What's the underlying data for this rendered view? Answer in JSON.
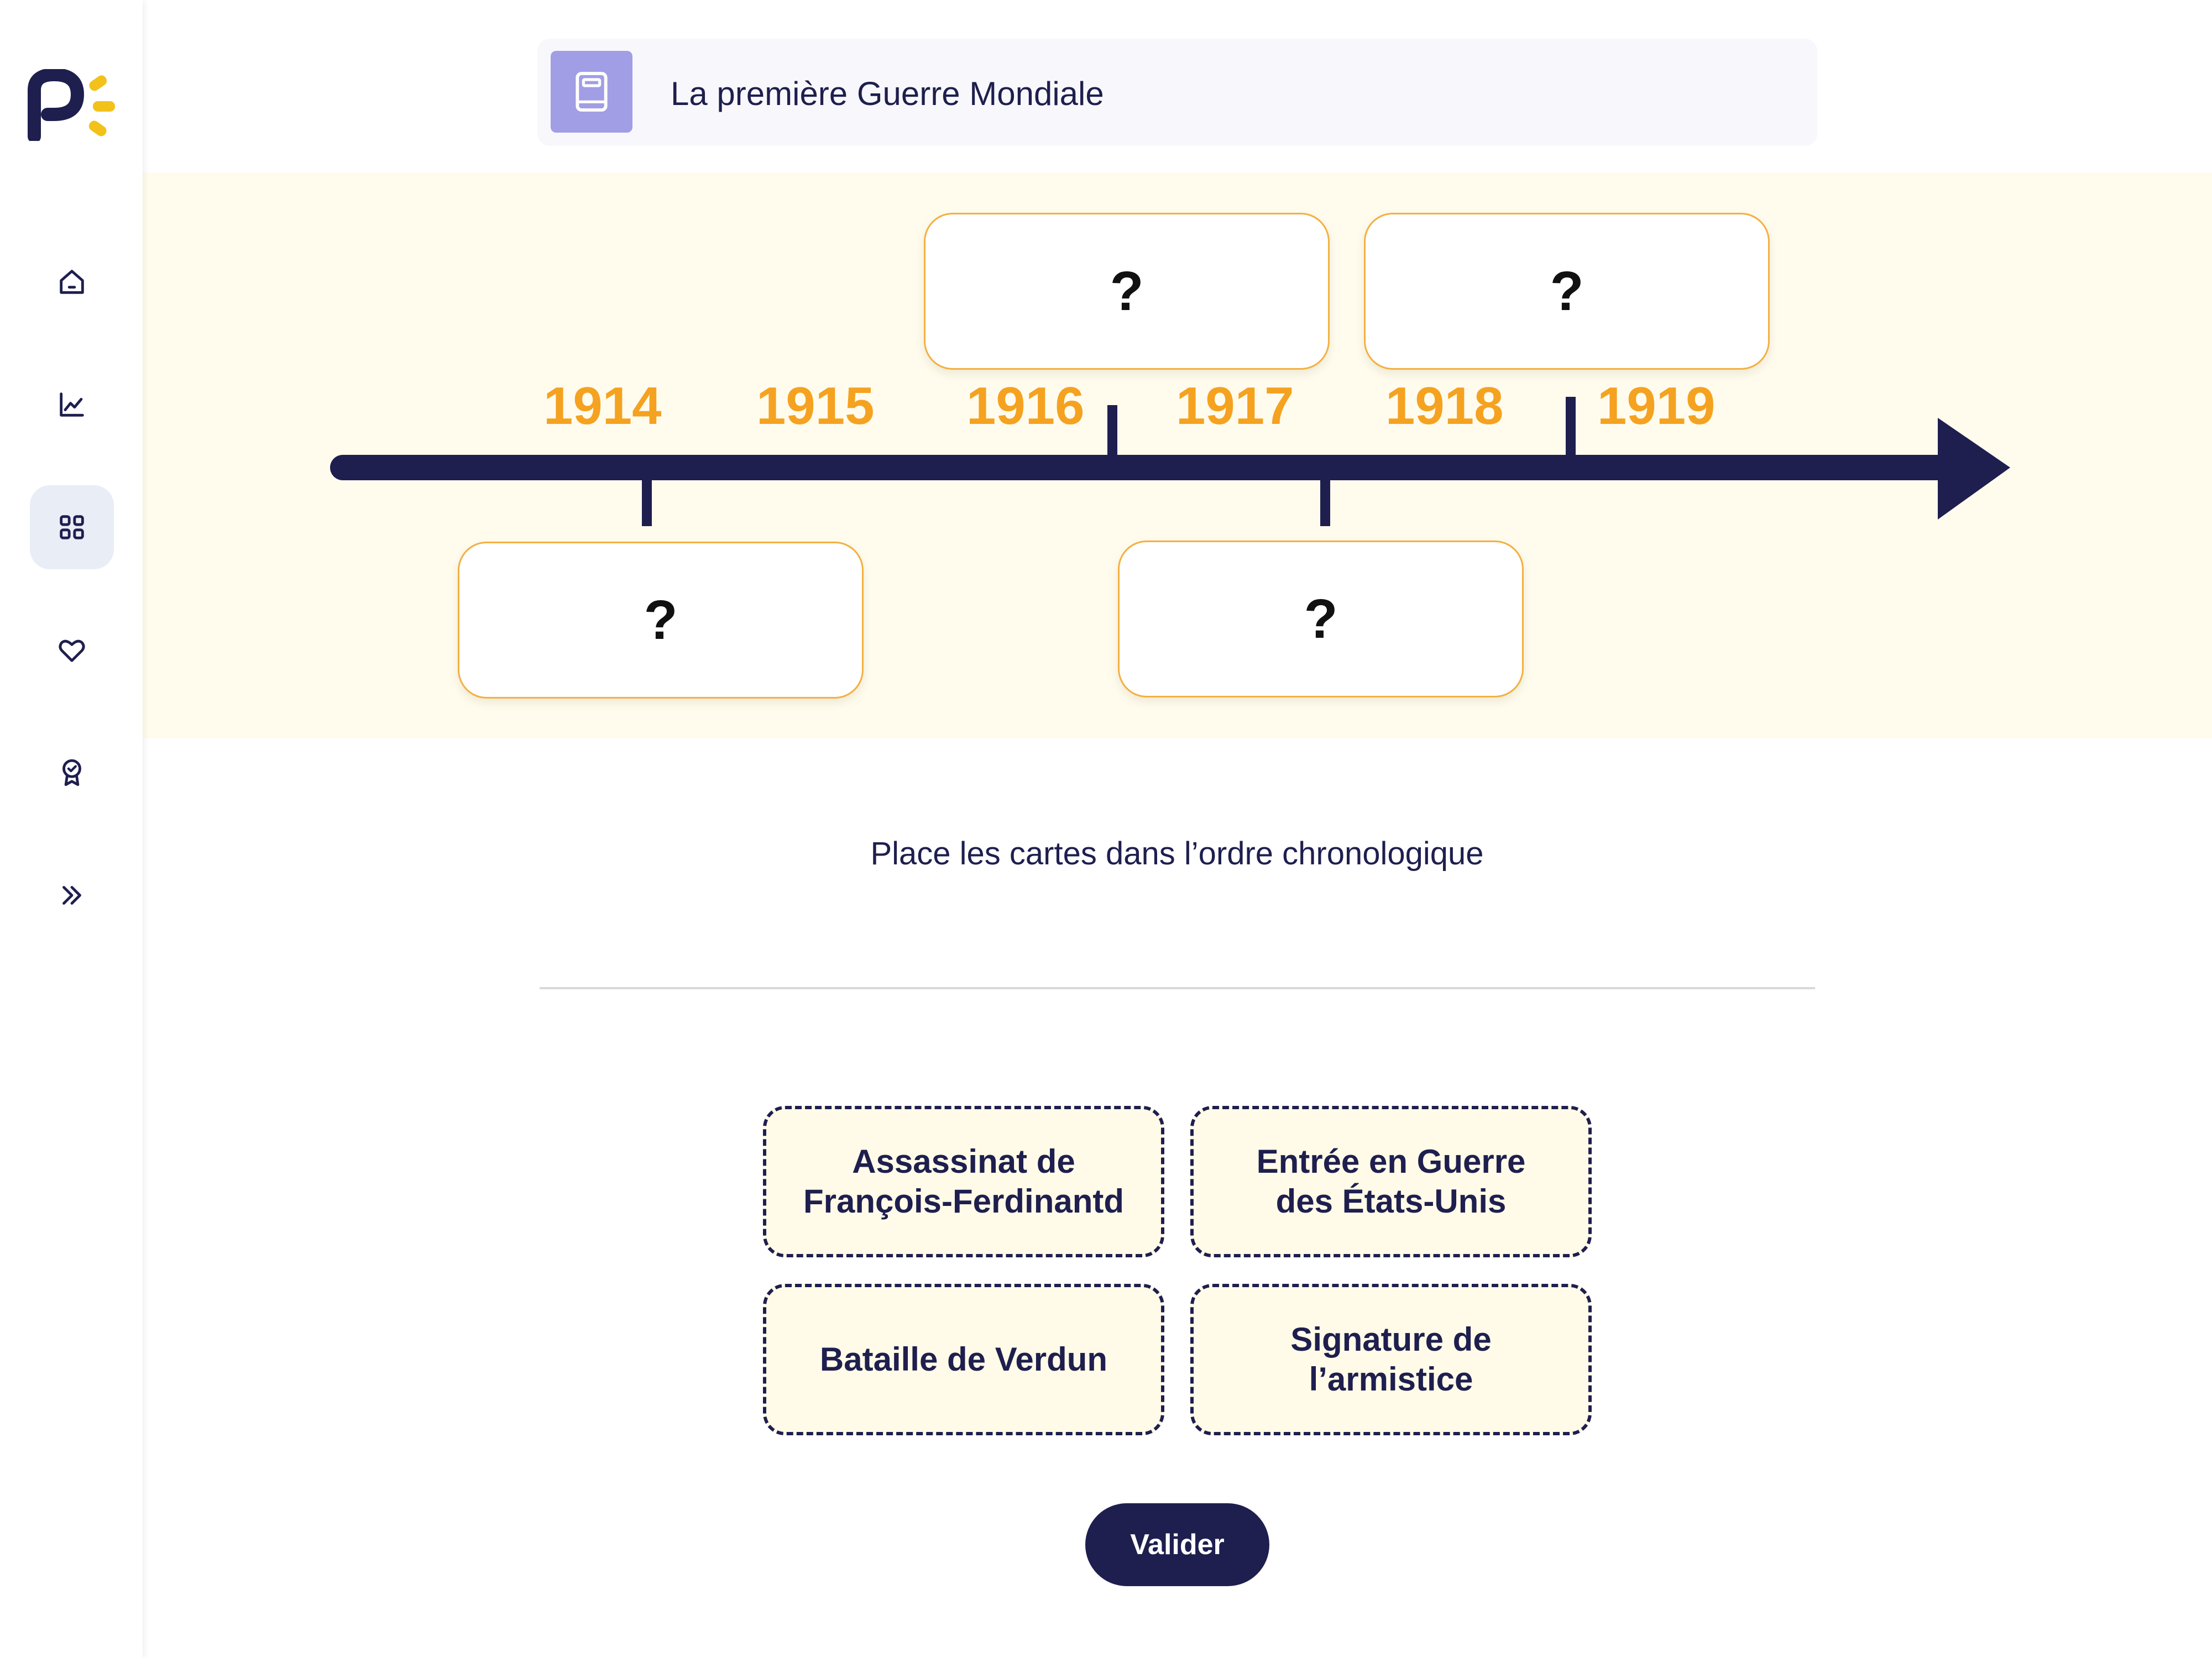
{
  "header": {
    "title": "La première Guerre Mondiale",
    "icon": "book-icon"
  },
  "sidebar": {
    "logo": "P",
    "items": [
      {
        "icon": "home-icon",
        "active": false
      },
      {
        "icon": "chart-line-icon",
        "active": false
      },
      {
        "icon": "grid-icon",
        "active": true
      },
      {
        "icon": "heart-icon",
        "active": false
      },
      {
        "icon": "award-icon",
        "active": false
      },
      {
        "icon": "double-chevron-right-icon",
        "active": false
      }
    ]
  },
  "timeline": {
    "years": [
      "1914",
      "1915",
      "1916",
      "1917",
      "1918",
      "1919"
    ],
    "slots": [
      "?",
      "?",
      "?",
      "?"
    ]
  },
  "instruction": "Place les cartes dans l’ordre chronologique",
  "cards": [
    "Assassinat de\nFrançois-Ferdinantd",
    "Entrée en Guerre\ndes États-Unis",
    "Bataille de Verdun",
    "Signature de\nl’armistice"
  ],
  "actions": {
    "validate": "Valider"
  },
  "colors": {
    "navy": "#1e1f4e",
    "year_orange": "#f5a220",
    "slot_border": "#f4b041",
    "timeline_bg": "#fffcee",
    "card_bg": "#fffbe8",
    "book_tile": "#a19ee6",
    "active_nav": "#e9edf6",
    "logo_yellow": "#f2c21b"
  }
}
